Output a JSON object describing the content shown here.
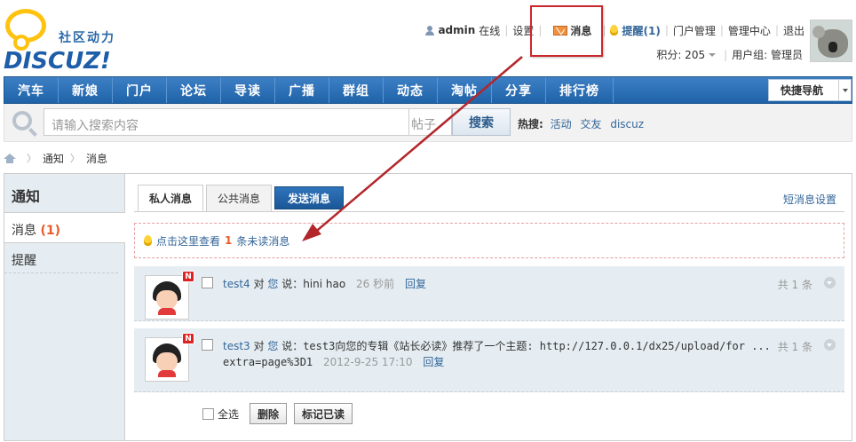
{
  "brand": {
    "tagline": "社区动力",
    "wordmark": "DISCUZ!"
  },
  "usernav": {
    "username": "admin",
    "status": "在线",
    "settings": "设置",
    "messages": "消息",
    "reminders": "提醒(1)",
    "portal_admin": "门户管理",
    "admin_center": "管理中心",
    "logout": "退出"
  },
  "userinfo": {
    "points": "积分: 205",
    "group": "用户组: 管理员"
  },
  "nav": {
    "items": [
      "汽车",
      "新娘",
      "门户",
      "论坛",
      "导读",
      "广播",
      "群组",
      "动态",
      "淘帖",
      "分享",
      "排行榜"
    ],
    "quick": "快捷导航"
  },
  "search": {
    "placeholder": "请输入搜索内容",
    "type": "帖子",
    "button": "搜索",
    "hot_label": "热搜:",
    "hot": [
      "活动",
      "交友",
      "discuz"
    ]
  },
  "breadcrumb": {
    "items": [
      "通知",
      "消息"
    ]
  },
  "sidebar": {
    "title": "通知",
    "items": [
      {
        "label": "消息",
        "count": "(1)"
      },
      {
        "label": "提醒"
      }
    ]
  },
  "tabs": {
    "private": "私人消息",
    "public": "公共消息",
    "send": "发送消息",
    "settings": "短消息设置"
  },
  "notice": {
    "pre": "点击这里查看",
    "count": "1",
    "post": "条未读消息"
  },
  "messages": [
    {
      "user": "test4",
      "to": "对",
      "you": "您",
      "says": "说：hini hao",
      "time": "26 秒前",
      "reply": "回复",
      "count": "共 1 条",
      "badge": "N"
    },
    {
      "user": "test3",
      "to": "对",
      "you": "您",
      "says": "说：test3向您的专辑《站长必读》推荐了一个主题: http://127.0.0.1/dx25/upload/for ...",
      "line2": "extra=page%3D1",
      "time": "2012-9-25 17:10",
      "reply": "回复",
      "count": "共 1 条",
      "badge": "N"
    }
  ],
  "actions": {
    "select_all": "全选",
    "delete": "删除",
    "mark_read": "标记已读"
  },
  "colors": {
    "nav_blue": "#2a6fb6",
    "highlight_red": "#c9282d",
    "accent_orange": "#e85b2a",
    "link": "#336699"
  }
}
